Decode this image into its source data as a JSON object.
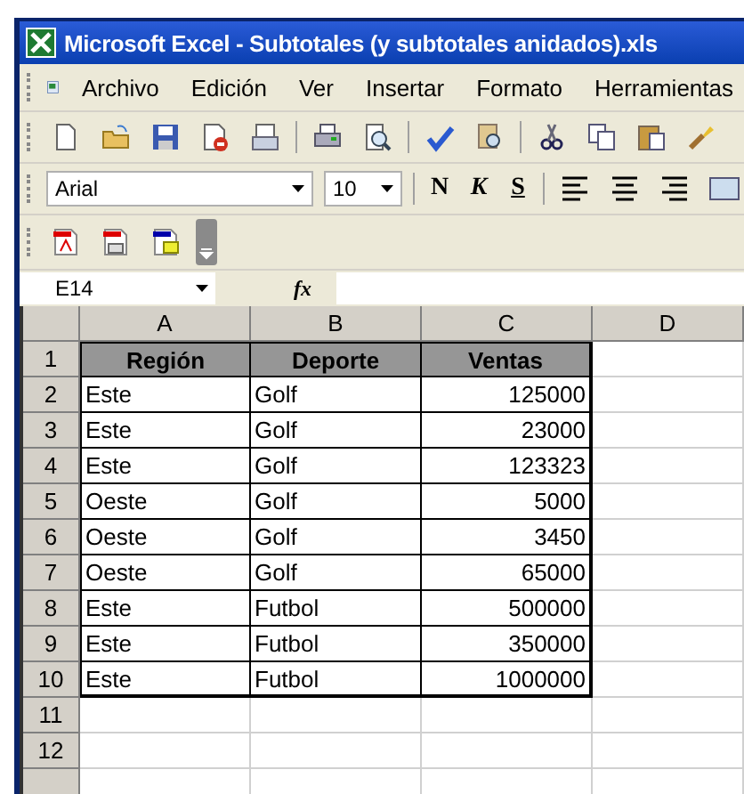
{
  "window": {
    "title": "Microsoft Excel - Subtotales (y subtotales anidados).xls"
  },
  "menu": [
    "Archivo",
    "Edición",
    "Ver",
    "Insertar",
    "Formato",
    "Herramientas"
  ],
  "format_toolbar": {
    "font": "Arial",
    "size": "10",
    "bold": "N",
    "italic": "K",
    "underline": "S"
  },
  "formula_bar": {
    "name_box": "E14",
    "fx": "fx"
  },
  "table": {
    "columns": [
      {
        "label": "A",
        "kind": "text"
      },
      {
        "label": "B",
        "kind": "text"
      },
      {
        "label": "C",
        "kind": "number"
      },
      {
        "label": "D",
        "kind": "text"
      }
    ],
    "rows": [
      {
        "number": "1",
        "kind": "header",
        "cells": [
          "Región",
          "Deporte",
          "Ventas"
        ]
      },
      {
        "number": "2",
        "kind": "data",
        "cells": [
          "Este",
          "Golf",
          "125000"
        ]
      },
      {
        "number": "3",
        "kind": "data",
        "cells": [
          "Este",
          "Golf",
          "23000"
        ]
      },
      {
        "number": "4",
        "kind": "data",
        "cells": [
          "Este",
          "Golf",
          "123323"
        ]
      },
      {
        "number": "5",
        "kind": "data",
        "cells": [
          "Oeste",
          "Golf",
          "5000"
        ]
      },
      {
        "number": "6",
        "kind": "data",
        "cells": [
          "Oeste",
          "Golf",
          "3450"
        ]
      },
      {
        "number": "7",
        "kind": "data",
        "cells": [
          "Oeste",
          "Golf",
          "65000"
        ]
      },
      {
        "number": "8",
        "kind": "data",
        "cells": [
          "Este",
          "Futbol",
          "500000"
        ]
      },
      {
        "number": "9",
        "kind": "data",
        "cells": [
          "Este",
          "Futbol",
          "350000"
        ]
      },
      {
        "number": "10",
        "kind": "data",
        "cells": [
          "Este",
          "Futbol",
          "1000000"
        ]
      },
      {
        "number": "11",
        "kind": "empty",
        "cells": []
      },
      {
        "number": "12",
        "kind": "empty",
        "cells": []
      }
    ]
  }
}
